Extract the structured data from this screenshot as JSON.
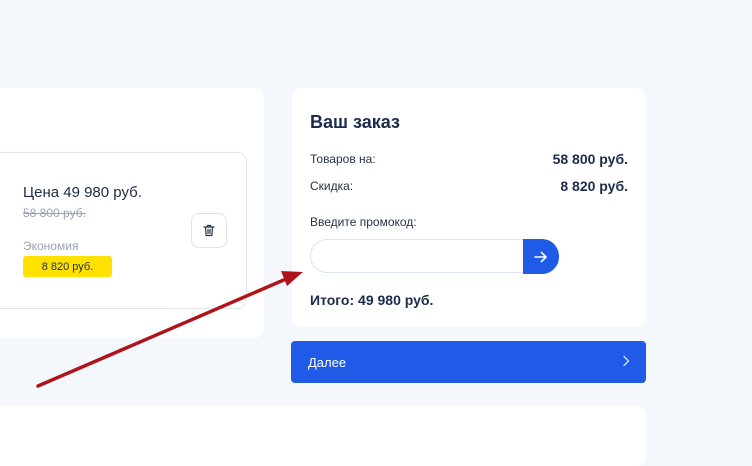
{
  "product": {
    "price_current": "Цена 49 980 руб.",
    "price_old": "58 800 руб.",
    "savings_label": "Экономия",
    "savings_value": "8 820 руб."
  },
  "order": {
    "title": "Ваш заказ",
    "items_label": "Товаров на:",
    "items_value": "58 800 руб.",
    "discount_label": "Скидка:",
    "discount_value": "8 820 руб.",
    "promo_label": "Введите промокод:",
    "promo_value": "",
    "total": "Итого: 49 980 руб."
  },
  "next_button": {
    "label": "Далее"
  },
  "colors": {
    "accent": "#1f5be6",
    "badge": "#ffe100",
    "annotation_arrow": "#b0141b",
    "background": "#f4f7fc"
  },
  "icons": [
    "trash-icon",
    "arrow-right-icon",
    "chevron-right-icon"
  ]
}
